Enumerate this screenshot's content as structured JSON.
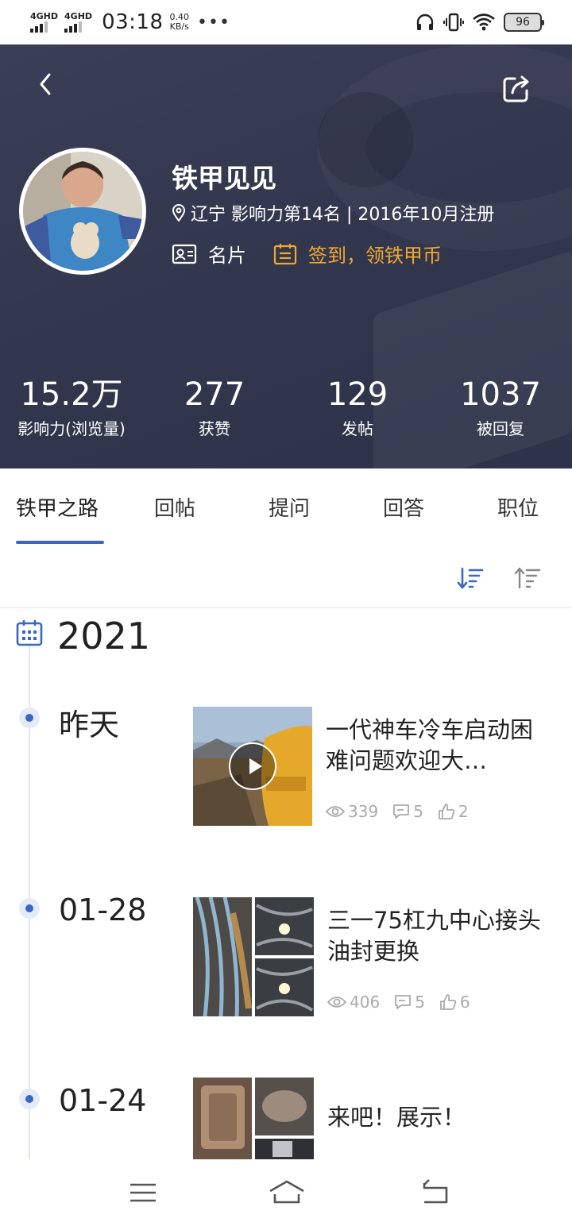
{
  "status_bar": {
    "sim1": "4GHD",
    "sim2": "4GHD",
    "time": "03:18",
    "speed_value": "0.40",
    "speed_unit": "KB/s",
    "more": "•••",
    "battery": "96"
  },
  "profile": {
    "name": "铁甲见见",
    "info": "辽宁 影响力第14名 | 2016年10月注册",
    "card_label": "名片",
    "sign_label": "签到，领铁甲币"
  },
  "stats": [
    {
      "value": "15.2万",
      "label": "影响力(浏览量)"
    },
    {
      "value": "277",
      "label": "获赞"
    },
    {
      "value": "129",
      "label": "发帖"
    },
    {
      "value": "1037",
      "label": "被回复"
    }
  ],
  "tabs": [
    "铁甲之路",
    "回帖",
    "提问",
    "回答",
    "职位"
  ],
  "timeline": {
    "year": "2021",
    "posts": [
      {
        "date": "昨天",
        "title": "一代神车冷车启动困难问题欢迎大…",
        "views": "339",
        "comments": "5",
        "likes": "2"
      },
      {
        "date": "01-28",
        "title": "三一75杠九中心接头油封更换",
        "views": "406",
        "comments": "5",
        "likes": "6"
      },
      {
        "date": "01-24",
        "title": "来吧！展示！"
      }
    ]
  },
  "colors": {
    "accent": "#3a66c8",
    "sign": "#f0a82e",
    "header": "#363a52"
  }
}
